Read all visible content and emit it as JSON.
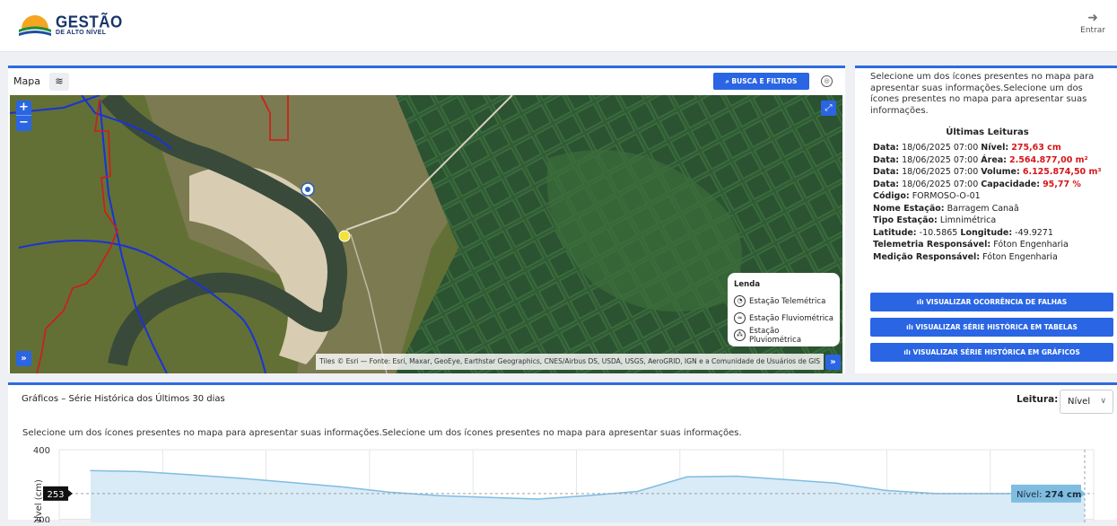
{
  "header": {
    "logo_title": "GESTÃO",
    "logo_subtitle": "DE ALTO NÍVEL",
    "login_icon": "sign-in-icon",
    "login_label": "Entrar"
  },
  "map": {
    "title": "Mapa",
    "layers_icon": "layers-icon",
    "search_button": "BUSCA E FILTROS",
    "globe_icon": "globe-icon",
    "zoom_in": "+",
    "zoom_out": "−",
    "attribution": "Tiles © Esri — Fonte: Esri, Maxar, GeoEye, Earthstar Geographics, CNES/Airbus DS, USDA, USGS, AeroGRID, IGN e a Comunidade de Usuários de GIS",
    "legend": {
      "title": "Lenda",
      "items": [
        {
          "label": "Estação Telemétrica",
          "icon": "telemetric-station-icon"
        },
        {
          "label": "Estação Fluviométrica",
          "icon": "fluviometric-station-icon"
        },
        {
          "label": "Estação Pluviométrica",
          "icon": "pluviometric-station-icon"
        }
      ]
    },
    "colors": {
      "boundary_blue": "#1a33d6",
      "boundary_red": "#d41a1a",
      "marker_yellow": "#f2e23a",
      "marker_blue": "#2c5fb8"
    }
  },
  "info": {
    "intro": "Selecione um dos ícones presentes no mapa para apresentar suas informações.Selecione um dos ícones presentes no mapa para apresentar suas informações.",
    "heading": "Últimas Leituras",
    "readings": [
      {
        "prefix": "Data:",
        "date": "18/06/2025 07:00",
        "label": "Nível:",
        "value": "275,63 cm"
      },
      {
        "prefix": "Data:",
        "date": "18/06/2025 07:00",
        "label": "Área:",
        "value": "2.564.877,00 m²"
      },
      {
        "prefix": "Data:",
        "date": "18/06/2025 07:00",
        "label": "Volume:",
        "value": "6.125.874,50 m³"
      },
      {
        "prefix": "Data:",
        "date": "18/06/2025 07:00",
        "label": "Capacidade:",
        "value": "95,77 %"
      }
    ],
    "fields": [
      {
        "label": "Código:",
        "value": "FORMOSO-O-01"
      },
      {
        "label": "Nome Estação:",
        "value": "Barragem Canaã"
      },
      {
        "label": "Tipo Estação:",
        "value": "Limnimétrica"
      }
    ],
    "coords": {
      "lat_label": "Latitude:",
      "lat": "-10.5865",
      "lon_label": "Longitude:",
      "lon": "-49.9271"
    },
    "responsible": [
      {
        "label": "Telemetria Responsável:",
        "value": "Fóton Engenharia"
      },
      {
        "label": "Medição Responsável:",
        "value": "Fóton Engenharia"
      }
    ],
    "buttons": [
      "ılı VISUALIZAR OCORRÊNCIA DE FALHAS",
      "ılı VISUALIZAR SÉRIE HISTÓRICA EM TABELAS",
      "ılı VISUALIZAR SÉRIE HISTÓRICA EM GRÁFICOS"
    ]
  },
  "chart_panel": {
    "title": "Gráficos – Série Histórica dos Últimos 30 dias",
    "leitura_label": "Leitura:",
    "leitura_value": "Nível",
    "intro": "Selecione um dos ícones presentes no mapa para apresentar suas informações.Selecione um dos ícones presentes no mapa para apresentar suas informações."
  },
  "chart_data": {
    "type": "area",
    "ylabel": "Nível (cm)",
    "yticks": [
      400,
      200
    ],
    "ylim": [
      0,
      400
    ],
    "series": [
      {
        "name": "Nível",
        "values": [
          340,
          337,
          328,
          318,
          306,
          294,
          278,
          268,
          263,
          258,
          268,
          280,
          322,
          324,
          314,
          304,
          283,
          274,
          274,
          274,
          274
        ]
      }
    ],
    "crosshair_value": "253",
    "tooltip": {
      "label": "Nível:",
      "value": "274 cm"
    },
    "colors": {
      "line": "#7fbde0",
      "fill": "#d9ebf7"
    }
  }
}
